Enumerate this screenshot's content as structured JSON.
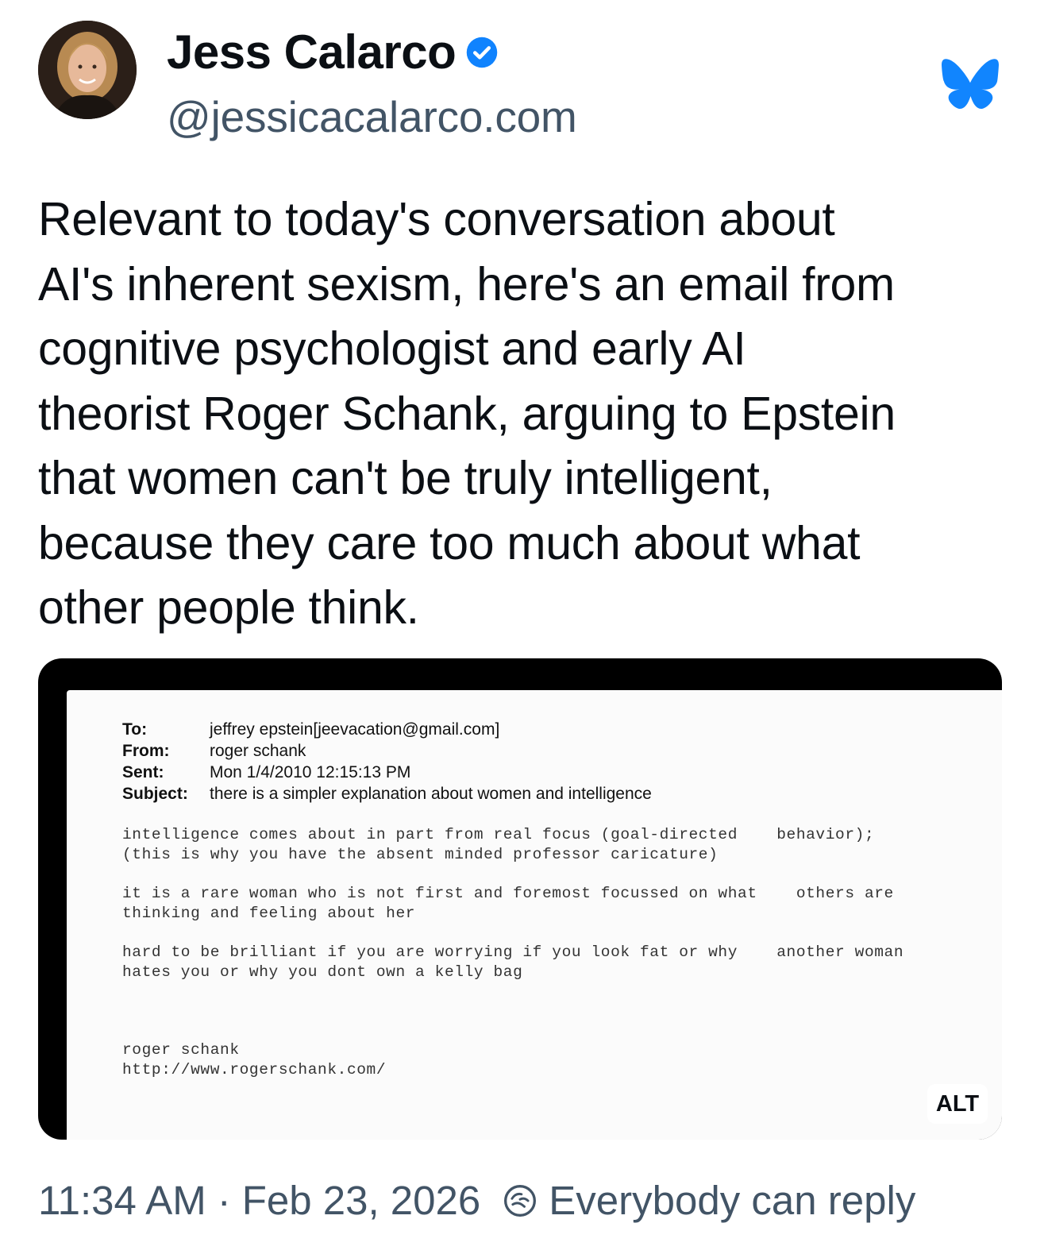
{
  "author": {
    "display_name": "Jess Calarco",
    "handle": "@jessicacalarco.com",
    "verified": true,
    "verified_color": "#1083fe"
  },
  "platform_icon": "bluesky-butterfly-icon",
  "brand_color": "#1185fe",
  "post": {
    "lines": [
      "Relevant to today's conversation about",
      "AI's inherent sexism, here's an email from",
      "cognitive psychologist and early AI",
      "theorist Roger Schank, arguing to Epstein",
      "that women can't be truly intelligent,",
      "because they care too much about what",
      "other people think."
    ]
  },
  "image": {
    "alt_badge": "ALT",
    "email": {
      "to_label": "To:",
      "to_value": "jeffrey epstein[jeevacation@gmail.com]",
      "from_label": "From:",
      "from_value": "roger schank",
      "sent_label": "Sent:",
      "sent_value": "Mon 1/4/2010 12:15:13 PM",
      "subject_label": "Subject:",
      "subject_value": "there is a simpler explanation about women and intelligence",
      "paragraph_1": "intelligence comes about in part from real focus (goal-directed    behavior);\n(this is why you have the absent minded professor caricature)",
      "paragraph_2": "it is a rare woman who is not first and foremost focussed on what    others are\nthinking and feeling about her",
      "paragraph_3": "hard to be brilliant if you are worrying if you look fat or why    another woman\nhates you or why you dont own a kelly bag",
      "signature": "roger schank\nhttp://www.rogerschank.com/"
    }
  },
  "footer": {
    "time": "11:34 AM",
    "separator": "·",
    "date": "Feb 23, 2026",
    "reply_icon": "reply-settings-icon",
    "reply_setting": "Everybody can reply"
  }
}
